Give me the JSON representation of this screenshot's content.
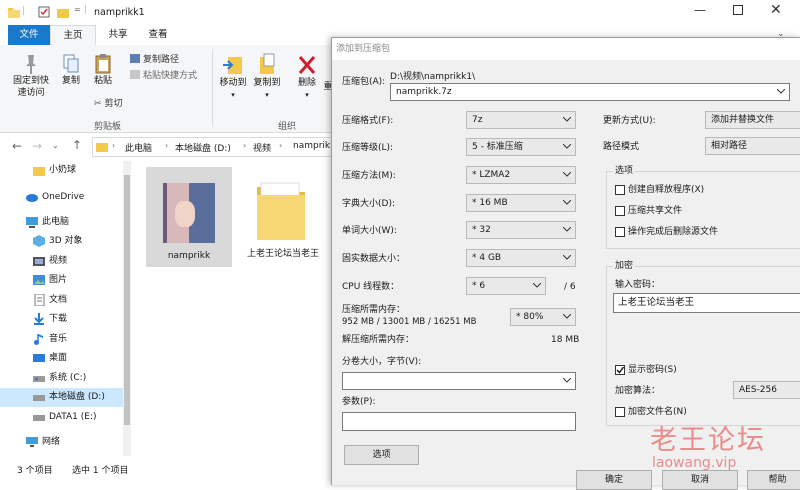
{
  "explorer": {
    "title": "namprikk1",
    "tabs": [
      "文件",
      "主页",
      "共享",
      "查看"
    ],
    "ribbon": {
      "clipboard": {
        "pin_label": "固定到快\n速访问",
        "copy_label": "复制",
        "paste_label": "粘贴",
        "copy_path": "复制路径",
        "paste_shortcut": "粘贴快捷方式",
        "cut": "剪切",
        "group_label": "剪贴板"
      },
      "organize": {
        "move_to": "移动到",
        "copy_to": "复制到",
        "delete": "删除",
        "rename_partial": "重",
        "group_label": "组织"
      }
    },
    "address": {
      "crumbs": [
        "此电脑",
        "本地磁盘 (D:)",
        "视频",
        "namprikk"
      ]
    },
    "nav": [
      {
        "label": "小奶球",
        "icon": "folder-icon"
      },
      {
        "label": "OneDrive",
        "icon": "cloud-icon"
      },
      {
        "label": "此电脑",
        "icon": "computer-icon"
      },
      {
        "label": "3D 对象",
        "icon": "3d-objects-icon"
      },
      {
        "label": "视频",
        "icon": "video-icon"
      },
      {
        "label": "图片",
        "icon": "pictures-icon"
      },
      {
        "label": "文档",
        "icon": "documents-icon"
      },
      {
        "label": "下载",
        "icon": "download-icon"
      },
      {
        "label": "音乐",
        "icon": "music-icon"
      },
      {
        "label": "桌面",
        "icon": "desktop-icon"
      },
      {
        "label": "系统 (C:)",
        "icon": "drive-icon"
      },
      {
        "label": "本地磁盘 (D:)",
        "icon": "drive-icon"
      },
      {
        "label": "DATA1 (E:)",
        "icon": "drive-icon"
      },
      {
        "label": "网络",
        "icon": "network-icon"
      }
    ],
    "files": [
      {
        "name": "namprikk",
        "type": "video"
      },
      {
        "name": "上老王论坛当老王",
        "type": "folder"
      }
    ],
    "status": {
      "count": "3 个项目",
      "selected": "选中 1 个项目"
    }
  },
  "dialog": {
    "title": "添加到压缩包",
    "archive_label": "压缩包(A):",
    "archive_path": "D:\\视频\\namprikk1\\",
    "archive_name": "namprikk.7z",
    "left": {
      "format_label": "压缩格式(F):",
      "format_value": "7z",
      "level_label": "压缩等级(L):",
      "level_value": "5 - 标准压缩",
      "method_label": "压缩方法(M):",
      "method_value": "* LZMA2",
      "dict_label": "字典大小(D):",
      "dict_value": "* 16 MB",
      "word_label": "单词大小(W):",
      "word_value": "* 32",
      "solid_label": "固实数据大小：",
      "solid_value": "* 4 GB",
      "cpu_label": "CPU 线程数：",
      "cpu_value": "* 6",
      "cpu_total": "/ 6",
      "mem_label": "压缩所需内存：",
      "mem_detail": "952 MB / 13001 MB / 16251 MB",
      "mem_percent": "* 80%",
      "decomp_label": "解压缩所需内存：",
      "decomp_value": "18 MB",
      "split_label": "分卷大小，字节(V):",
      "split_value": "",
      "params_label": "参数(P):",
      "params_value": "",
      "options_button": "选项"
    },
    "right": {
      "update_label": "更新方式(U):",
      "update_value": "添加并替换文件",
      "pathmode_label": "路径模式",
      "pathmode_value": "相对路径",
      "options_group": "选项",
      "sfx": "创建自释放程序(X)",
      "shared": "压缩共享文件",
      "delete_after": "操作完成后删除源文件",
      "encryption_group": "加密",
      "password_label": "输入密码：",
      "password_value": "上老王论坛当老王",
      "show_password": "显示密码(S)",
      "show_password_checked": true,
      "enc_method_label": "加密算法：",
      "enc_method_value": "AES-256",
      "encrypt_names": "加密文件名(N)"
    },
    "buttons": {
      "ok": "确定",
      "cancel": "取消",
      "help": "帮助"
    }
  },
  "watermark": {
    "text": "老王论坛",
    "url": "laowang.vip"
  }
}
